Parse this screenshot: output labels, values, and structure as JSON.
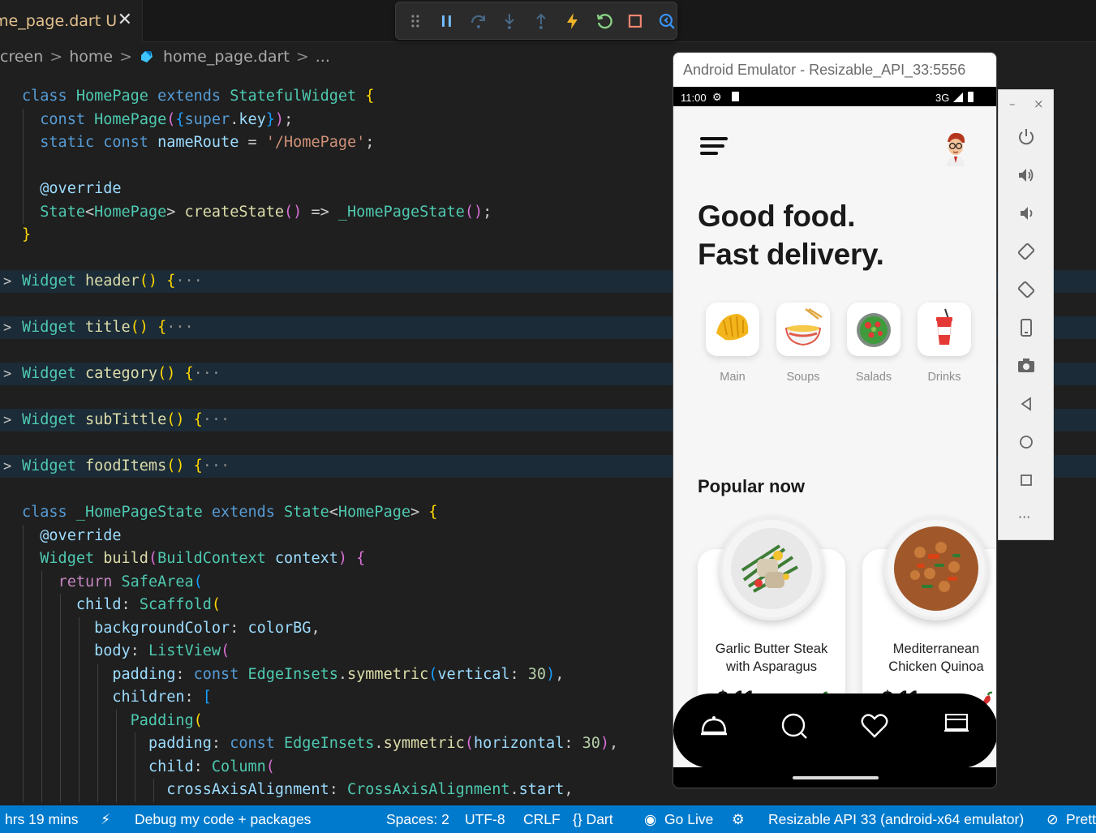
{
  "tab": {
    "filename": "me_page.dart",
    "status": "U",
    "close": "✕"
  },
  "breadcrumb": {
    "items": [
      "creen",
      "home",
      "home_page.dart",
      "..."
    ],
    "separator": ">"
  },
  "editor": {
    "lines": [
      {
        "html": "<span class='k'>class</span> <span class='t'>HomePage</span> <span class='k'>extends</span> <span class='t'>StatefulWidget</span> <span class='b1'>{</span>"
      },
      {
        "html": "  <span class='k'>const</span> <span class='t'>HomePage</span><span class='b2'>(</span><span class='b3'>{</span><span class='k'>super</span>.<span class='v'>key</span><span class='b3'>}</span><span class='b2'>)</span>;"
      },
      {
        "html": "  <span class='k'>static</span> <span class='k'>const</span> <span class='v'>nameRoute</span> = <span class='s'>'/HomePage'</span>;"
      },
      {
        "html": ""
      },
      {
        "html": "  <span class='v'>@override</span>"
      },
      {
        "html": "  <span class='t'>State</span>&lt;<span class='t'>HomePage</span>&gt; <span class='f'>createState</span><span class='b2'>()</span> =&gt; <span class='t'>_HomePageState</span><span class='b2'>()</span>;"
      },
      {
        "html": "<span class='b1'>}</span>"
      },
      {
        "html": ""
      },
      {
        "html": "<span class='t'>Widget</span> <span class='f'>header</span><span class='b1'>()</span> <span class='b1'>{</span><span class='dots'>···</span>",
        "fold": true
      },
      {
        "html": ""
      },
      {
        "html": "<span class='t'>Widget</span> <span class='f'>title</span><span class='b1'>()</span> <span class='b1'>{</span><span class='dots'>···</span>",
        "fold": true
      },
      {
        "html": ""
      },
      {
        "html": "<span class='t'>Widget</span> <span class='f'>category</span><span class='b1'>()</span> <span class='b1'>{</span><span class='dots'>···</span>",
        "fold": true
      },
      {
        "html": ""
      },
      {
        "html": "<span class='t'>Widget</span> <span class='f'>subTittle</span><span class='b1'>()</span> <span class='b1'>{</span><span class='dots'>···</span>",
        "fold": true
      },
      {
        "html": ""
      },
      {
        "html": "<span class='t'>Widget</span> <span class='f'>foodItems</span><span class='b1'>()</span> <span class='b1'>{</span><span class='dots'>···</span>",
        "fold": true
      },
      {
        "html": ""
      },
      {
        "html": "<span class='k'>class</span> <span class='t'>_HomePageState</span> <span class='k'>extends</span> <span class='t'>State</span>&lt;<span class='t'>HomePage</span>&gt; <span class='b1'>{</span>"
      },
      {
        "html": "  <span class='v'>@override</span>"
      },
      {
        "html": "  <span class='t'>Widget</span> <span class='f'>build</span><span class='b2'>(</span><span class='t'>BuildContext</span> <span class='v'>context</span><span class='b2'>)</span> <span class='b2'>{</span>"
      },
      {
        "html": "    <span class='kc'>return</span> <span class='t'>SafeArea</span><span class='b3'>(</span>"
      },
      {
        "html": "      <span class='v'>child</span>: <span class='t'>Scaffold</span><span class='b1'>(</span>"
      },
      {
        "html": "        <span class='v'>backgroundColor</span>: <span class='v'>colorBG</span>,"
      },
      {
        "html": "        <span class='v'>body</span>: <span class='t'>ListView</span><span class='b2'>(</span>"
      },
      {
        "html": "          <span class='v'>padding</span>: <span class='k'>const</span> <span class='t'>EdgeInsets</span>.<span class='f'>symmetric</span><span class='b3'>(</span><span class='v'>vertical</span>: <span class='n'>30</span><span class='b3'>)</span>,"
      },
      {
        "html": "          <span class='v'>children</span>: <span class='b3'>[</span>"
      },
      {
        "html": "            <span class='t'>Padding</span><span class='b1'>(</span>"
      },
      {
        "html": "              <span class='v'>padding</span>: <span class='k'>const</span> <span class='t'>EdgeInsets</span>.<span class='f'>symmetric</span><span class='b2'>(</span><span class='v'>horizontal</span>: <span class='n'>30</span><span class='b2'>)</span>,"
      },
      {
        "html": "              <span class='v'>child</span>: <span class='t'>Column</span><span class='b2'>(</span>"
      },
      {
        "html": "                <span class='v'>crossAxisAlignment</span>: <span class='t'>CrossAxisAlignment</span>.<span class='v'>start</span>,"
      }
    ]
  },
  "emulator": {
    "window_title": "Android Emulator - Resizable_API_33:5556",
    "status": {
      "time": "11:00",
      "network": "3G"
    },
    "headline": [
      "Good food.",
      "Fast delivery."
    ],
    "categories": [
      {
        "label": "Main",
        "icon": "dumpling-icon"
      },
      {
        "label": "Soups",
        "icon": "noodle-bowl-icon"
      },
      {
        "label": "Salads",
        "icon": "salad-icon"
      },
      {
        "label": "Drinks",
        "icon": "drink-cup-icon"
      }
    ],
    "section_title": "Popular now",
    "items": [
      {
        "name_1": "Garlic Butter Steak",
        "name_2": "with Asparagus",
        "price": "$ 11"
      },
      {
        "name_1": "Mediterranean",
        "name_2": "Chicken Quinoa",
        "price": "$ 11"
      }
    ],
    "side_controls": {
      "minimize": "–",
      "close": "×",
      "more": "···"
    }
  },
  "statusbar": {
    "timer": "hrs 19 mins",
    "debug_mode": "Debug my code + packages",
    "spaces": "Spaces: 2",
    "encoding": "UTF-8",
    "eol": "CRLF",
    "language": "{} Dart",
    "golive": "Go Live",
    "device": "Resizable API 33 (android-x64 emulator)",
    "prettier": "Prett"
  },
  "colors": {
    "status_bar": "#007acc",
    "editor_bg": "#1f1f1f",
    "accent_yellow": "#ffd700"
  }
}
